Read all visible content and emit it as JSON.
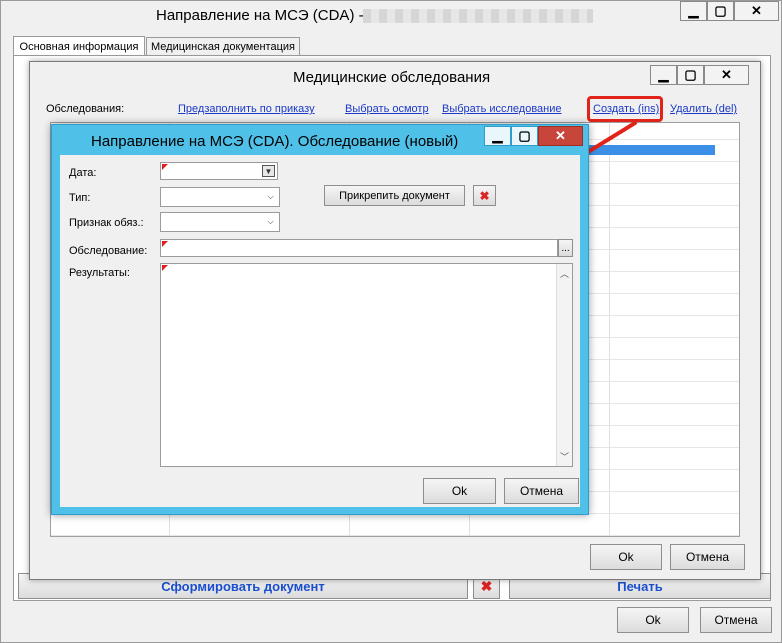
{
  "main_window": {
    "title": "Направление на МСЭ (CDA) -",
    "tabs": [
      {
        "label": "Основная информация"
      },
      {
        "label": "Медицинская документация"
      }
    ],
    "form_document_label": "Сформировать документ",
    "print_label": "Печать",
    "ok_label": "Ok",
    "cancel_label": "Отмена"
  },
  "exams_window": {
    "title": "Медицинские обследования",
    "exams_label": "Обследования:",
    "links": {
      "prefill": "Предзаполнить по приказу",
      "select_checkup": "Выбрать осмотр",
      "select_study": "Выбрать исследование",
      "create": "Создать (ins)",
      "delete": "Удалить (del)"
    },
    "ok_label": "Ok",
    "cancel_label": "Отмена"
  },
  "new_exam_dialog": {
    "title": "Направление на МСЭ (CDA). Обследование (новый)",
    "date_label": "Дата:",
    "type_label": "Тип:",
    "mandatory_label": "Признак обяз.:",
    "exam_label": "Обследование:",
    "results_label": "Результаты:",
    "attach_label": "Прикрепить документ",
    "ellipsis": "...",
    "ok_label": "Ok",
    "cancel_label": "Отмена"
  },
  "colors": {
    "highlight": "#e2231a",
    "accent_blue": "#4fc0e8",
    "link": "#1a39c8"
  }
}
